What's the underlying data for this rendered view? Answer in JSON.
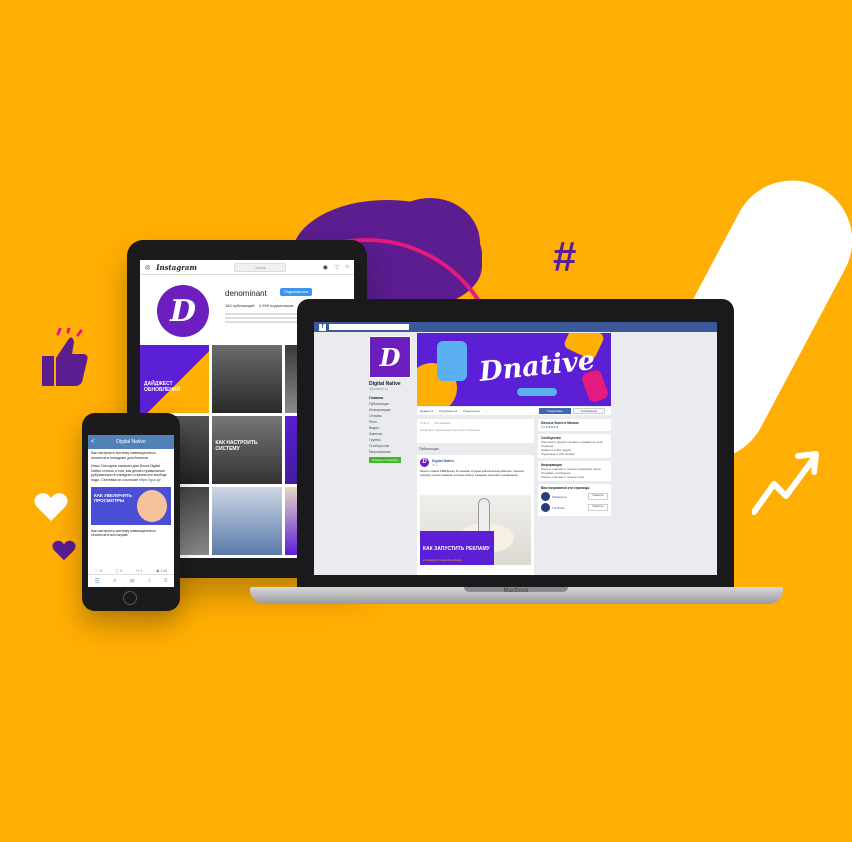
{
  "colors": {
    "background": "#FFAE03",
    "purple": "#5B1D8F",
    "brand_violet": "#6C1FBE",
    "pink": "#E5197E",
    "facebook_blue": "#3B5998",
    "vk_blue": "#5181B8",
    "instagram_blue": "#3897F0"
  },
  "decor": {
    "hashtag": "#"
  },
  "tablet": {
    "app_name": "Instagram",
    "search_placeholder": "Поиск",
    "username": "denominant",
    "follow_label": "Подписаться",
    "posts_count": "164 публикаций",
    "followers_count": "4 999 подписчиков",
    "avatar_letter": "D",
    "grid": [
      {
        "caption": "ДАЙДЖЕСТ ОБНОВЛЕНИЙ"
      },
      {
        "caption": ""
      },
      {
        "caption": ""
      },
      {
        "caption": ""
      },
      {
        "caption": "КАК НАСТРОИТЬ СИСТЕМУ"
      },
      {
        "caption": ""
      }
    ]
  },
  "phone": {
    "header_title": "Digital Native",
    "back_label": "<",
    "post_title": "Как настроить систему навигационных хештегов в Instagram для бизнеса",
    "post_body": "Илья Спесарев написал для блога Digital Native статью о том, как делать правильные рубрикаторы в Instagram и зачем это вообще надо.",
    "post_link_prefix": "Статейка по ссылочке",
    "post_link": "https://goo.gl/",
    "image_caption": "КАК УВЕЛИЧИТЬ ПРОСМОТРЫ",
    "card_text": "Как настроить систему навигационных хештегов в инстаграм",
    "actions": {
      "likes": "8",
      "comments": "3",
      "reposts": "1",
      "views": "126"
    }
  },
  "laptop": {
    "brand": "MacBook",
    "page": {
      "avatar_letter": "D",
      "name": "Digital Native",
      "handle": "@dnative.ru",
      "menu": [
        "Главная",
        "Публикации",
        "Информация",
        "Отзывы",
        "Фото",
        "Видео",
        "Заметки",
        "Группы",
        "Сообщество",
        "Мероприятия"
      ],
      "cta": "Создать Страницу"
    },
    "cover_word": "Dnative",
    "actions": [
      "Нравится",
      "Подписаться",
      "Поделиться",
      "..."
    ],
    "buttons": {
      "more": "Подробнее",
      "message": "Сообщение"
    },
    "composer_placeholder": "Напишите публикацию для этой Страницы",
    "composer_tabs": [
      "Статус",
      "Фото/видео"
    ],
    "feed_label": "Публикации",
    "post": {
      "author": "Digital Native",
      "time": "21 ч",
      "text": "Украли топовую SMM-фишку 10 приемов, которые действительно работают. Сделали подборку лучших сервисов, которые помогут в ведении соцсетей и продвижении.",
      "banner_title": "КАК ЗАПУСТИТЬ РЕКЛАМУ",
      "banner_sub": "в Instagram через Facebook"
    },
    "sidebar": {
      "box1_title": "Личные блоги в Минске",
      "rating": "5,0 ★★★★★",
      "box2_title": "Сообщество",
      "box2_items": [
        "Пригласите друзей поставить «Нравится» этой Странице",
        "Нравится 2 316 людям",
        "Подписаны 2 346 человек"
      ],
      "box3_title": "Информация",
      "box3_items": [
        "Обычно отвечает в течение нескольких часов",
        "Отправить сообщение",
        "Обычно отвечает в течение часа"
      ],
      "suggest_title": "Вам понравятся эти страницы",
      "suggestions": [
        {
          "name": "Malakeeva",
          "like": "Нравится"
        },
        {
          "name": "TuttiPolla",
          "like": "Нравится"
        }
      ]
    }
  }
}
